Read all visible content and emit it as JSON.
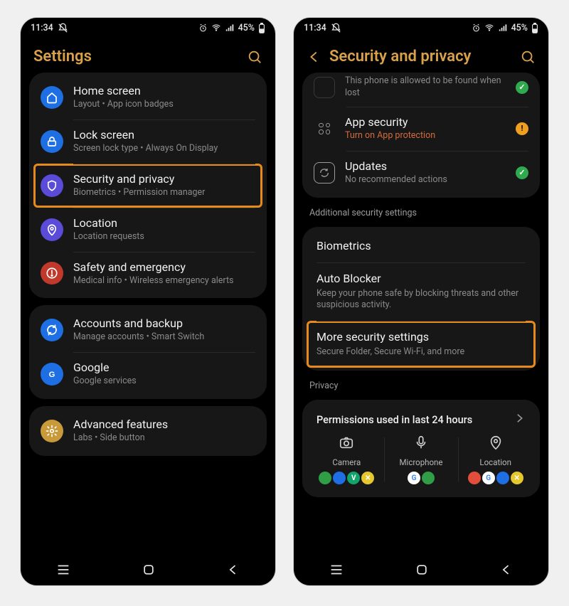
{
  "status": {
    "time": "11:34",
    "battery": "45%"
  },
  "settings_screen": {
    "title": "Settings",
    "groups": [
      {
        "items": [
          {
            "icon": "home",
            "bg": "#1d6fe3",
            "title": "Home screen",
            "sub": "Layout  •  App icon badges"
          },
          {
            "icon": "lock",
            "bg": "#1d6fe3",
            "title": "Lock screen",
            "sub": "Screen lock type  •  Always On Display"
          },
          {
            "icon": "shield",
            "bg": "#5a4bd8",
            "title": "Security and privacy",
            "sub": "Biometrics  •  Permission manager",
            "highlight": true
          },
          {
            "icon": "pin",
            "bg": "#5a4bd8",
            "title": "Location",
            "sub": "Location requests"
          },
          {
            "icon": "alert",
            "bg": "#c0392b",
            "title": "Safety and emergency",
            "sub": "Medical info  •  Wireless emergency alerts"
          }
        ]
      },
      {
        "items": [
          {
            "icon": "sync",
            "bg": "#1d6fe3",
            "title": "Accounts and backup",
            "sub": "Manage accounts  •  Smart Switch"
          },
          {
            "icon": "google",
            "bg": "#1d6fe3",
            "title": "Google",
            "sub": "Google services"
          }
        ]
      },
      {
        "items": [
          {
            "icon": "advanced",
            "bg": "#c89a3a",
            "title": "Advanced features",
            "sub": "Labs  •  Side button"
          }
        ]
      }
    ]
  },
  "security_screen": {
    "title": "Security and privacy",
    "top_cutoff": "This phone is allowed to be found when lost",
    "security_items": [
      {
        "icon": "apps",
        "title": "App security",
        "sub": "Turn on App protection",
        "warn": true,
        "status": "warn"
      },
      {
        "icon": "update",
        "title": "Updates",
        "sub": "No recommended actions",
        "status": "ok"
      }
    ],
    "additional_label": "Additional security settings",
    "additional": [
      {
        "title": "Biometrics"
      },
      {
        "title": "Auto Blocker",
        "sub": "Keep your phone safe by blocking threats and other suspicious activity."
      },
      {
        "title": "More security settings",
        "sub": "Secure Folder, Secure Wi-Fi, and more",
        "highlight": true
      }
    ],
    "privacy_label": "Privacy",
    "permissions_title": "Permissions used in last 24 hours",
    "permissions": [
      {
        "label": "Camera",
        "apps": [
          {
            "bg": "#2f9e46",
            "t": ""
          },
          {
            "bg": "#1d6fe3",
            "t": ""
          },
          {
            "bg": "#12a36a",
            "t": "V"
          },
          {
            "bg": "#e6c82d",
            "t": "✕"
          }
        ]
      },
      {
        "label": "Microphone",
        "apps": [
          {
            "bg": "#ffffff",
            "t": "G"
          },
          {
            "bg": "#2f9e46",
            "t": ""
          }
        ]
      },
      {
        "label": "Location",
        "apps": [
          {
            "bg": "#e24e3b",
            "t": ""
          },
          {
            "bg": "#ffffff",
            "t": "G"
          },
          {
            "bg": "#1d6fe3",
            "t": ""
          },
          {
            "bg": "#e6c82d",
            "t": "✕"
          }
        ]
      }
    ]
  }
}
